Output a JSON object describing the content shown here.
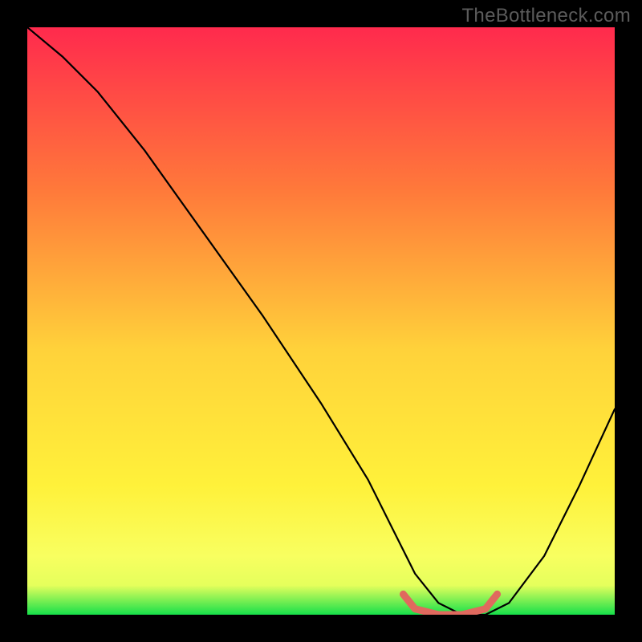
{
  "watermark": "TheBottleneck.com",
  "colors": {
    "bg": "#000000",
    "grad_top": "#ff2a4d",
    "grad_mid_upper": "#ff7a3a",
    "grad_mid": "#ffd23a",
    "grad_mid_lower": "#fff13a",
    "grad_low": "#f8ff60",
    "grad_band": "#e5ff5c",
    "grad_bottom": "#16e04a",
    "curve": "#000000",
    "highlight": "#e0695e"
  },
  "chart_data": {
    "type": "line",
    "title": "",
    "xlabel": "",
    "ylabel": "",
    "xlim": [
      0,
      100
    ],
    "ylim": [
      0,
      100
    ],
    "series": [
      {
        "name": "bottleneck-curve",
        "x": [
          0,
          6,
          12,
          20,
          30,
          40,
          50,
          58,
          62,
          66,
          70,
          74,
          78,
          82,
          88,
          94,
          100
        ],
        "y": [
          100,
          95,
          89,
          79,
          65,
          51,
          36,
          23,
          15,
          7,
          2,
          0,
          0,
          2,
          10,
          22,
          35
        ]
      },
      {
        "name": "optimal-range-marker",
        "x": [
          64,
          66,
          70,
          74,
          78,
          80
        ],
        "y": [
          3.5,
          1,
          0,
          0,
          1,
          3.5
        ]
      }
    ],
    "annotations": []
  }
}
